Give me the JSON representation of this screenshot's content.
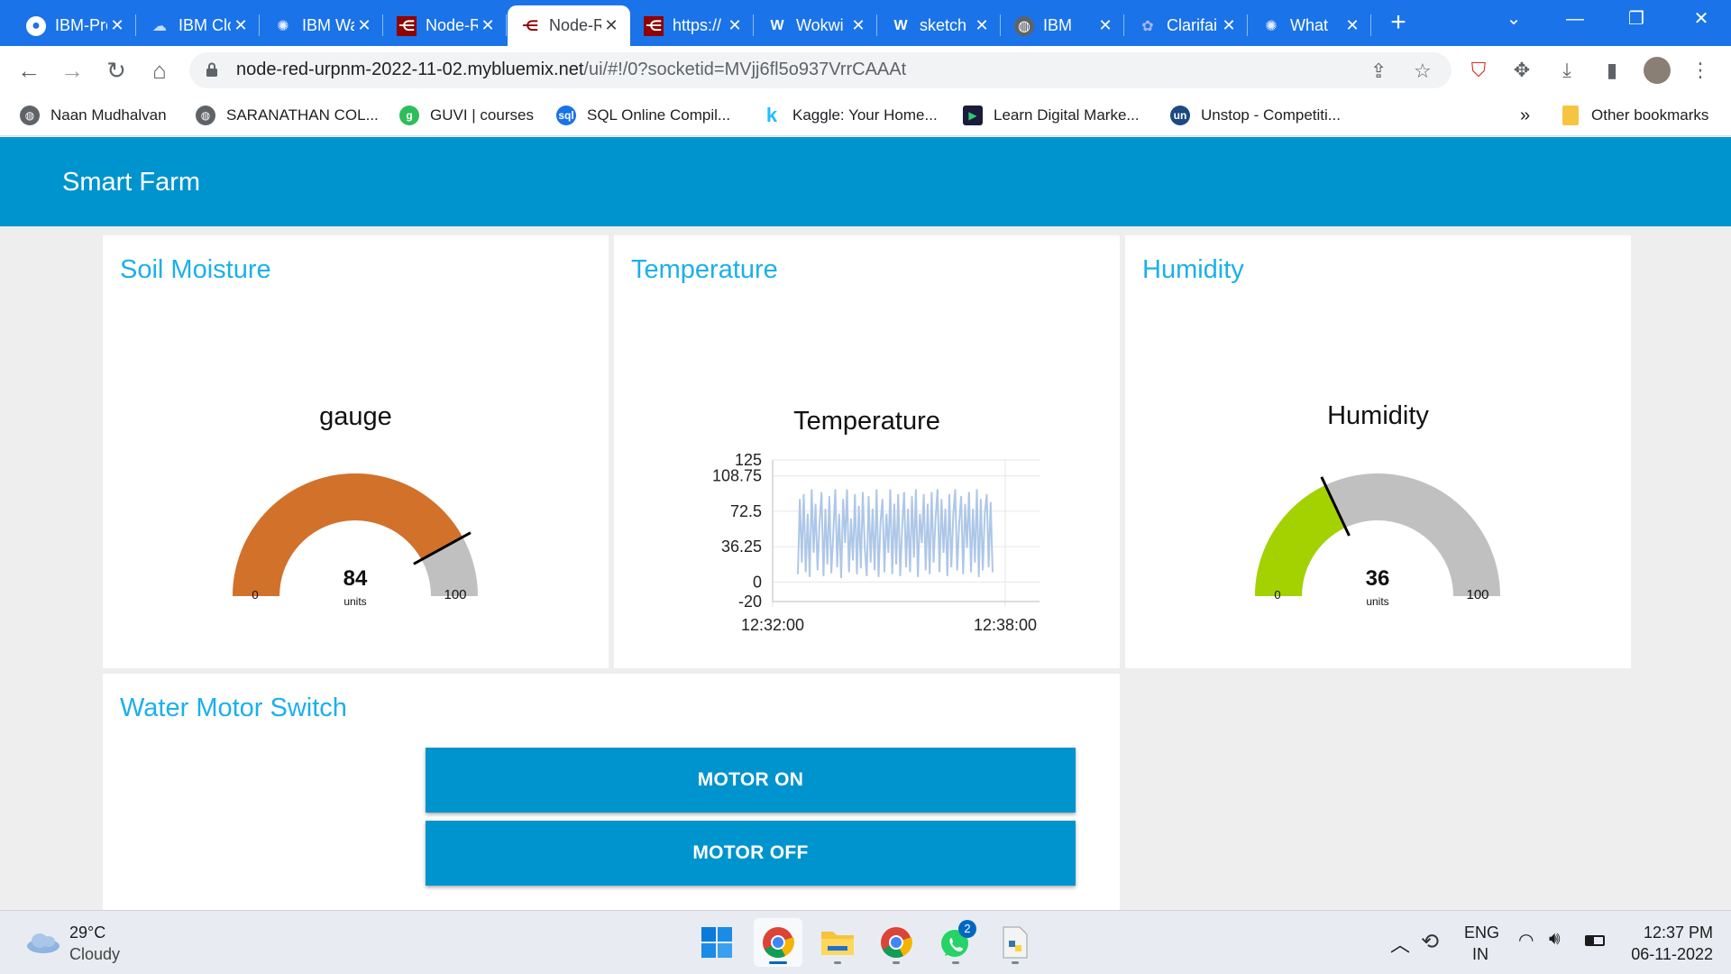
{
  "browser": {
    "tabs": [
      {
        "title": "IBM-Project-",
        "icon": "github-icon"
      },
      {
        "title": "IBM Cloud",
        "icon": "ibm-cloud-icon"
      },
      {
        "title": "IBM Watson",
        "icon": "watson-iot-icon"
      },
      {
        "title": "Node-RED",
        "icon": "node-red-icon"
      },
      {
        "title": "Node-RED Dashboard",
        "icon": "node-red-icon"
      },
      {
        "title": "https://",
        "icon": "node-red-icon"
      },
      {
        "title": "Wokwi",
        "icon": "wokwi-icon"
      },
      {
        "title": "sketch",
        "icon": "wokwi-icon"
      },
      {
        "title": "IBM",
        "icon": "globe-icon"
      },
      {
        "title": "Clarifai",
        "icon": "clarifai-icon"
      },
      {
        "title": "What",
        "icon": "watson-iot-icon"
      }
    ],
    "active_tab_index": 4,
    "url_host": "node-red-urpnm-2022-11-02.mybluemix.net",
    "url_rest": "/ui/#!/0?socketid=MVjj6fl5o937VrrCAAAt",
    "bookmarks": [
      {
        "label": "Naan Mudhalvan",
        "icon": "globe-icon",
        "color": "#5f6368"
      },
      {
        "label": "SARANATHAN COL...",
        "icon": "globe-icon",
        "color": "#5f6368"
      },
      {
        "label": "GUVI | courses",
        "icon": "guvi-icon",
        "color": "#2ebd59"
      },
      {
        "label": "SQL Online Compil...",
        "icon": "sql-icon",
        "color": "#1a73e8"
      },
      {
        "label": "Kaggle: Your Home...",
        "icon": "kaggle-icon",
        "color": "#20beff"
      },
      {
        "label": "Learn Digital Marke...",
        "icon": "play-icon",
        "color": "#1b1b3a"
      },
      {
        "label": "Unstop - Competiti...",
        "icon": "unstop-icon",
        "color": "#1c4980"
      }
    ],
    "more_bookmarks": "»",
    "other_bookmarks": "Other bookmarks"
  },
  "dashboard": {
    "title": "Smart Farm",
    "soil": {
      "card_title": "Soil Moisture",
      "widget_title": "gauge",
      "value": 84,
      "min": 0,
      "max": 100,
      "value_text": "84",
      "units": "units",
      "min_text": "0",
      "max_text": "100",
      "color": "#d2712a"
    },
    "temperature": {
      "card_title": "Temperature",
      "widget_title": "Temperature"
    },
    "humidity": {
      "card_title": "Humidity",
      "widget_title": "Humidity",
      "value": 36,
      "min": 0,
      "max": 100,
      "value_text": "36",
      "units": "units",
      "min_text": "0",
      "max_text": "100",
      "color": "#a4d200"
    },
    "motor": {
      "card_title": "Water Motor Switch",
      "on_label": "MOTOR ON",
      "off_label": "MOTOR OFF"
    }
  },
  "chart_data": {
    "type": "line",
    "title": "Temperature",
    "xlabel": "",
    "ylabel": "",
    "x_ticks": [
      "12:32:00",
      "12:38:00"
    ],
    "y_ticks": [
      "125",
      "108.75",
      "72.5",
      "36.25",
      "0",
      "-20"
    ],
    "ylim": [
      -20,
      125
    ],
    "grid": true,
    "series": [
      {
        "color": "#aec7e8",
        "values": [
          8,
          85,
          20,
          90,
          10,
          70,
          5,
          95,
          30,
          80,
          12,
          60,
          92,
          6,
          75,
          18,
          88,
          9,
          50,
          95,
          15,
          70,
          4,
          85,
          40,
          95,
          10,
          65,
          22,
          90,
          8,
          78,
          14,
          92,
          35,
          6,
          88,
          20,
          75,
          12,
          95,
          5,
          60,
          85,
          10,
          70,
          30,
          95,
          8,
          80,
          18,
          90,
          6,
          55,
          92,
          15,
          75,
          10,
          88,
          25,
          95,
          5,
          70,
          40,
          90,
          12,
          80,
          8,
          92,
          20,
          65,
          95,
          10,
          85,
          30,
          75,
          6,
          90,
          15,
          70,
          95,
          12,
          60,
          88,
          8,
          80,
          35,
          92,
          10,
          75,
          20,
          95,
          5,
          85,
          12,
          70,
          90,
          15,
          82,
          10
        ]
      }
    ]
  },
  "taskbar": {
    "weather_temp": "29°C",
    "weather_desc": "Cloudy",
    "lang_top": "ENG",
    "lang_bottom": "IN",
    "time": "12:37 PM",
    "date": "06-11-2022",
    "whatsapp_badge": "2"
  }
}
